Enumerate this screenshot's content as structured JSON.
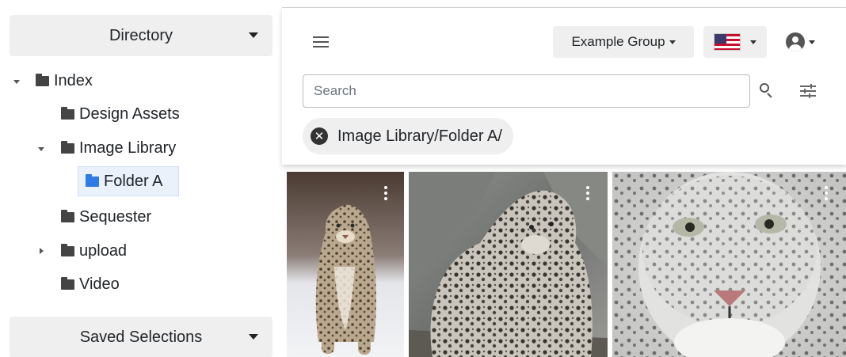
{
  "sidebar": {
    "directory_label": "Directory",
    "saved_selections_label": "Saved Selections",
    "tree": [
      {
        "label": "Index",
        "expanded": true
      },
      {
        "label": "Design Assets"
      },
      {
        "label": "Image Library",
        "expanded": true
      },
      {
        "label": "Folder A",
        "selected": true
      },
      {
        "label": "Sequester"
      },
      {
        "label": "upload",
        "expanded": false
      },
      {
        "label": "Video"
      }
    ]
  },
  "header": {
    "group_label": "Example Group",
    "language_flag": "us-flag-icon",
    "user_icon": "user-circle-icon",
    "menu_icon": "hamburger-menu-icon"
  },
  "search": {
    "placeholder": "Search",
    "value": ""
  },
  "filter_chip": {
    "label": "Image Library/Folder A/"
  },
  "images": [
    {
      "subject": "snow leopard walking on snow"
    },
    {
      "subject": "snow leopard on rocks"
    },
    {
      "subject": "snow leopard face close-up"
    }
  ],
  "colors": {
    "accent_folder": "#2f7be5",
    "panel_bg": "#efefef",
    "selected_bg": "#eaf1fb"
  }
}
